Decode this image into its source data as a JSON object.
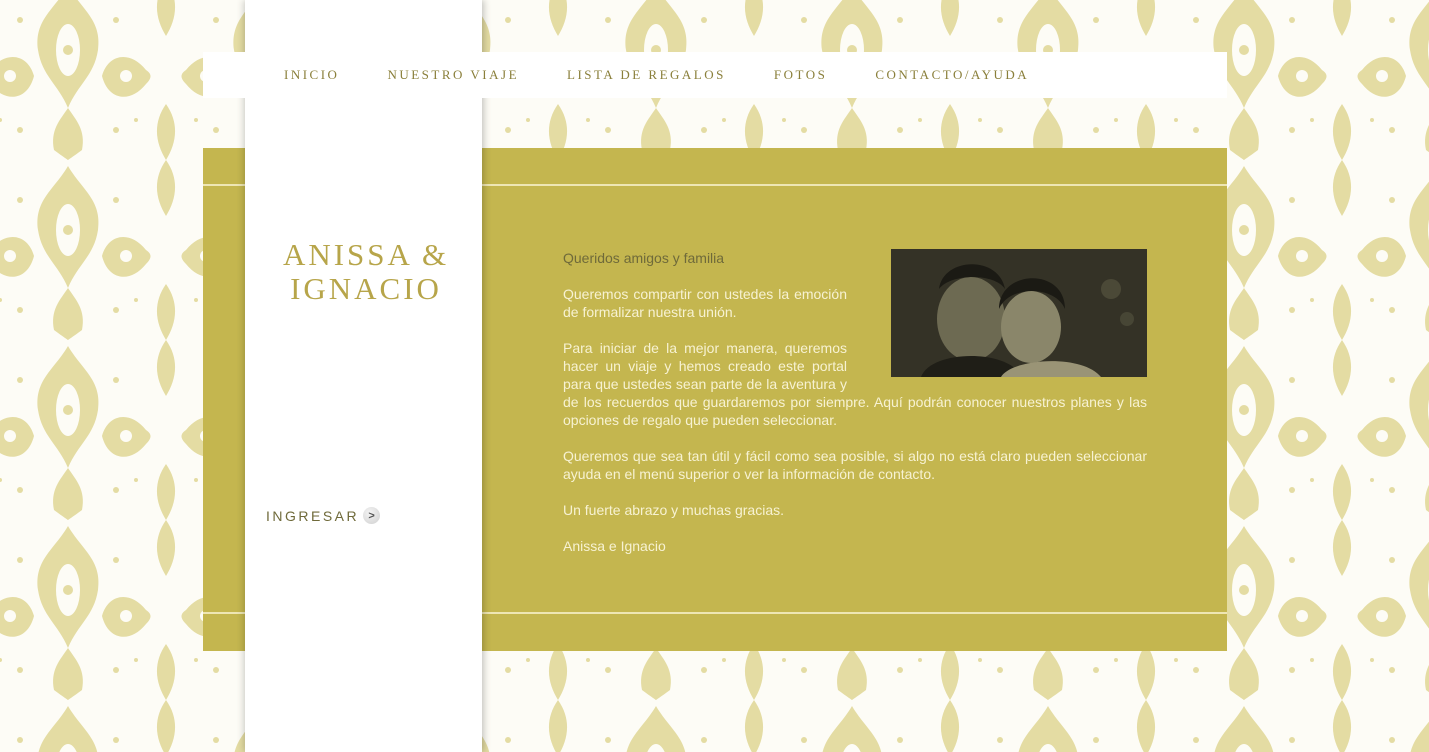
{
  "nav": {
    "items": [
      {
        "label": "INICIO"
      },
      {
        "label": "NUESTRO VIAJE"
      },
      {
        "label": "LISTA DE REGALOS"
      },
      {
        "label": "FOTOS"
      },
      {
        "label": "CONTACTO/AYUDA"
      }
    ]
  },
  "sidebar": {
    "title_line1": "ANISSA &",
    "title_line2": "IGNACIO",
    "enter_label": "INGRESAR",
    "enter_arrow": ">"
  },
  "message": {
    "greeting": "Queridos amigos y familia",
    "paragraphs": [
      "Queremos compartir con ustedes la emoción de formalizar nuestra unión.",
      "Para iniciar de la mejor manera, queremos hacer un viaje y hemos creado este portal para que ustedes sean parte de la aventura y de los recuerdos que guardaremos por siempre. Aquí podrán conocer nuestros planes y las opciones de regalo que pueden seleccionar.",
      "Queremos que sea tan útil y fácil como sea posible, si algo no está claro pueden seleccionar ayuda en el menú superior o ver la información de contacto.",
      "Un fuerte abrazo y muchas gracias.",
      "Anissa e Ignacio"
    ]
  },
  "colors": {
    "gold_panel": "#c4b64f",
    "title_gold": "#b7a54a",
    "damask": "#e4dca3",
    "body_text": "#f7f2d2"
  }
}
